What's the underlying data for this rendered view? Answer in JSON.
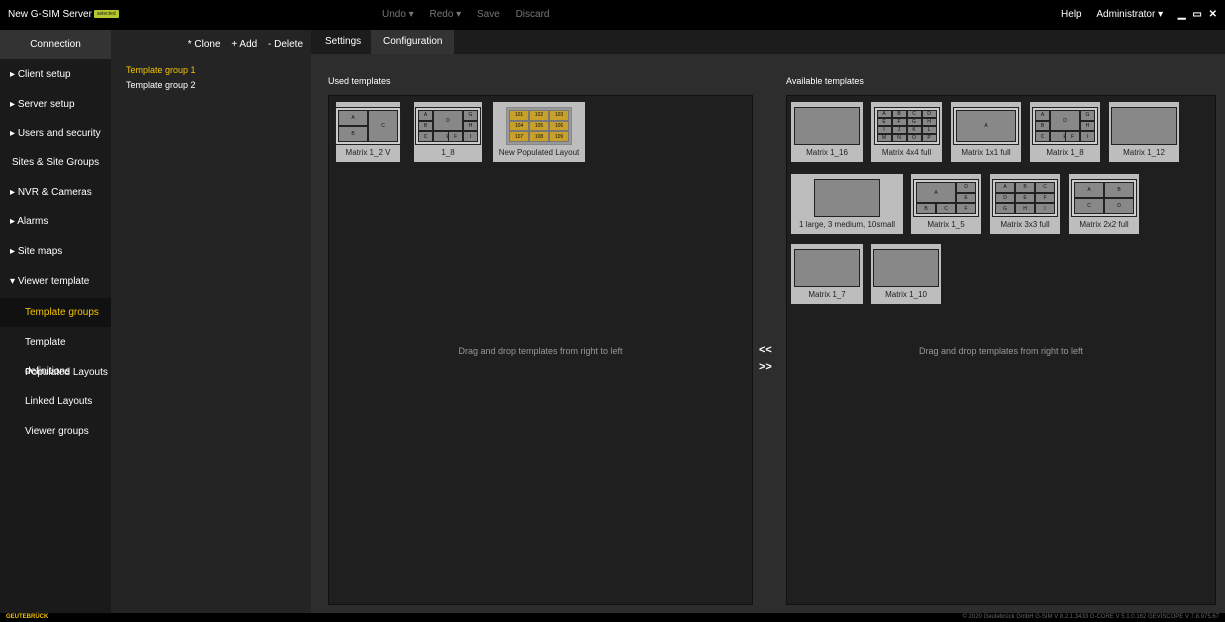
{
  "topbar": {
    "app_title": "New G-SIM Server",
    "badge": "selected",
    "undo": "Undo ▾",
    "redo": "Redo ▾",
    "save": "Save",
    "discard": "Discard",
    "help": "Help",
    "user": "Administrator ▾",
    "minimize": "▁",
    "maximize": "▭",
    "close": "✕"
  },
  "sidebar": {
    "items": [
      {
        "label": "Connection"
      },
      {
        "label": "Client setup",
        "arrow": "▸"
      },
      {
        "label": "Server setup",
        "arrow": "▸"
      },
      {
        "label": "Users and security",
        "arrow": "▸"
      },
      {
        "label": "Sites & Site Groups"
      },
      {
        "label": "NVR & Cameras",
        "arrow": "▸"
      },
      {
        "label": "Alarms",
        "arrow": "▸"
      },
      {
        "label": "Site maps",
        "arrow": "▸"
      },
      {
        "label": "Viewer template",
        "arrow": "▾"
      },
      {
        "label": "Template groups"
      },
      {
        "label": "Template definitions"
      },
      {
        "label": "Populated Layouts"
      },
      {
        "label": "Linked Layouts"
      },
      {
        "label": "Viewer groups"
      }
    ]
  },
  "groups": {
    "clone": "* Clone",
    "add": "+ Add",
    "delete": "- Delete",
    "items": [
      "Template group 1",
      "Template group 2"
    ]
  },
  "tabs": [
    "Settings",
    "Configuration"
  ],
  "used": {
    "title": "Used templates",
    "hint": "Drag and drop templates from right to left",
    "templates": [
      {
        "label": "Matrix 1_2 V",
        "cells": [
          "A",
          "C",
          "B"
        ]
      },
      {
        "label": "1_8",
        "cells": [
          "A",
          "D",
          "G",
          "B",
          "H",
          "C",
          "E",
          "F",
          "I"
        ]
      },
      {
        "label": "New Populated Layout",
        "cells": [
          "101",
          "102",
          "103",
          "104",
          "105",
          "106",
          "107",
          "108",
          "109"
        ]
      }
    ]
  },
  "arrows": {
    "left": "<<",
    "right": ">>"
  },
  "available": {
    "title": "Available templates",
    "hint": "Drag and drop templates from right to left",
    "templates": [
      {
        "label": "Matrix 1_16"
      },
      {
        "label": "Matrix 4x4 full",
        "cells": [
          "A",
          "B",
          "C",
          "D",
          "E",
          "F",
          "G",
          "H",
          "I",
          "J",
          "K",
          "L",
          "M",
          "N",
          "O",
          "P"
        ]
      },
      {
        "label": "Matrix 1x1 full",
        "cells": [
          "A"
        ]
      },
      {
        "label": "Matrix 1_8",
        "cells": [
          "A",
          "D",
          "G",
          "B",
          "H",
          "C",
          "E",
          "F",
          "I"
        ]
      },
      {
        "label": "Matrix 1_12"
      },
      {
        "label": "1 large, 3 medium, 10small"
      },
      {
        "label": "Matrix 1_5",
        "cells": [
          "A",
          "D",
          "E",
          "B",
          "C",
          "F"
        ]
      },
      {
        "label": "Matrix 3x3 full",
        "cells": [
          "A",
          "B",
          "C",
          "D",
          "E",
          "F",
          "G",
          "H",
          "I"
        ]
      },
      {
        "label": "Matrix 2x2 full",
        "cells": [
          "A",
          "B",
          "C",
          "D"
        ]
      },
      {
        "label": "Matrix 1_7"
      },
      {
        "label": "Matrix 1_10"
      }
    ]
  },
  "footer": {
    "logo": "GEUTEBRÜCK",
    "copyright": "© 2020 Geutebrück GmbH   G-SIM V 8.2.1.3433   G-CORE V 5.1.0.162   GEVISCOPE V 7.8.975.67"
  }
}
